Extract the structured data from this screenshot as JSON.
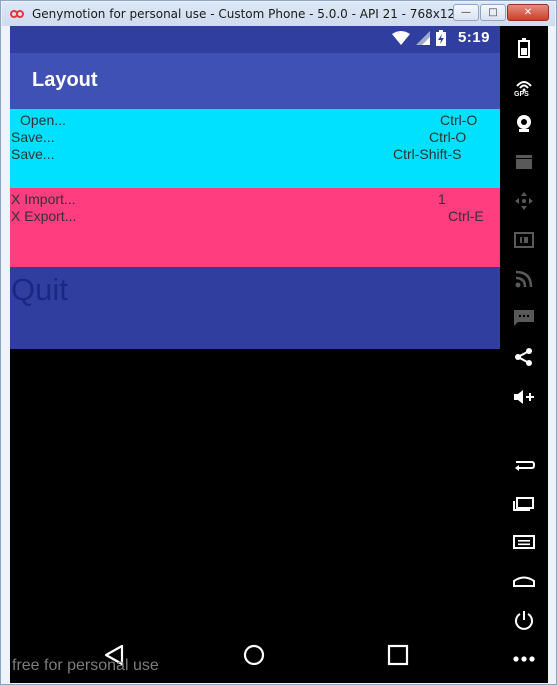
{
  "window": {
    "title": "Genymotion for personal use - Custom Phone - 5.0.0 - API 21 - 768x12...",
    "minimize_label": "—",
    "maximize_label": "□",
    "close_label": "✕"
  },
  "statusbar": {
    "time": "5:19",
    "icons": [
      "wifi-icon",
      "signal-icon",
      "battery-charging-icon"
    ]
  },
  "appbar": {
    "title": "Layout"
  },
  "menu": {
    "open": {
      "label": "Open...",
      "shortcut": "Ctrl-O"
    },
    "save1": {
      "label": "Save...",
      "shortcut": "Ctrl-O"
    },
    "save2": {
      "label": "Save...",
      "shortcut": "Ctrl-Shift-S"
    },
    "import": {
      "label": "X Import...",
      "shortcut": "1"
    },
    "export": {
      "label": "X Export...",
      "shortcut": "Ctrl-E"
    },
    "quit": {
      "label": "Quit"
    }
  },
  "navbar": {
    "watermark": "free for personal use",
    "icons": [
      "back-icon",
      "home-icon",
      "recent-apps-icon"
    ]
  },
  "sidebar": {
    "gps_label": "GPS",
    "icons": [
      "battery-icon",
      "gps-icon",
      "webcam-icon",
      "video-capture-icon",
      "dpad-icon",
      "device-id-icon",
      "rss-icon",
      "sms-icon",
      "share-icon",
      "volume-icon",
      "rotate-icon",
      "recent-apps-icon",
      "menu-icon",
      "home-icon",
      "power-icon",
      "more-icon"
    ]
  },
  "colors": {
    "statusbar": "#303f9f",
    "appbar": "#3f51b5",
    "cyan_section": "#00e0ff",
    "pink_section": "#ff3d7f",
    "navy_section": "#303f9f"
  }
}
